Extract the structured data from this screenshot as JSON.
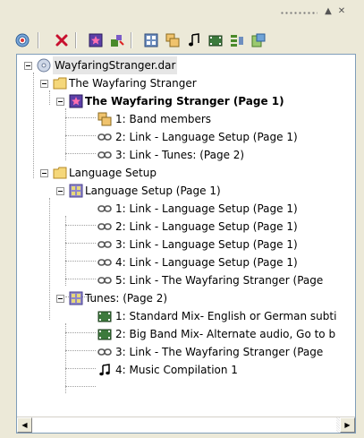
{
  "title_strip": {
    "pin_glyph": "▲",
    "close_glyph": "✕"
  },
  "toolbar": {
    "buttons": [
      {
        "icon": "target-icon"
      },
      {
        "icon": "delete-icon"
      },
      {
        "icon": "add-menu-icon"
      },
      {
        "icon": "add-link-icon"
      },
      {
        "icon": "add-track-icon"
      },
      {
        "icon": "add-slideshow-icon"
      },
      {
        "icon": "add-audio-icon"
      },
      {
        "icon": "add-film-icon"
      },
      {
        "icon": "add-playlist-icon"
      },
      {
        "icon": "add-folder-icon"
      }
    ]
  },
  "tree": {
    "root": {
      "label": "WayfaringStranger.dar"
    },
    "folder1": {
      "label": "The Wayfaring Stranger"
    },
    "menu1": {
      "label": "The Wayfaring Stranger  (Page 1)"
    },
    "menu1_items": [
      {
        "label": "1: Band members"
      },
      {
        "label": "2: Link - Language Setup (Page 1)"
      },
      {
        "label": "3: Link - Tunes: (Page 2)"
      }
    ],
    "folder2": {
      "label": "Language Setup"
    },
    "menu2": {
      "label": "Language Setup (Page 1)"
    },
    "menu2_items": [
      {
        "label": "1: Link - Language Setup (Page 1)"
      },
      {
        "label": "2: Link - Language Setup (Page 1)"
      },
      {
        "label": "3: Link - Language Setup (Page 1)"
      },
      {
        "label": "4: Link - Language Setup (Page 1)"
      },
      {
        "label": "5: Link - The Wayfaring Stranger  (Page"
      }
    ],
    "menu3": {
      "label": "Tunes: (Page 2)"
    },
    "menu3_items": [
      {
        "label": "1: Standard Mix- English or German subti"
      },
      {
        "label": "2: Big Band Mix-  Alternate audio, Go to b"
      },
      {
        "label": "3: Link - The Wayfaring Stranger  (Page"
      },
      {
        "label": "4: Music Compilation 1"
      }
    ]
  },
  "scrollbar": {
    "left_glyph": "◀",
    "right_glyph": "▶"
  }
}
